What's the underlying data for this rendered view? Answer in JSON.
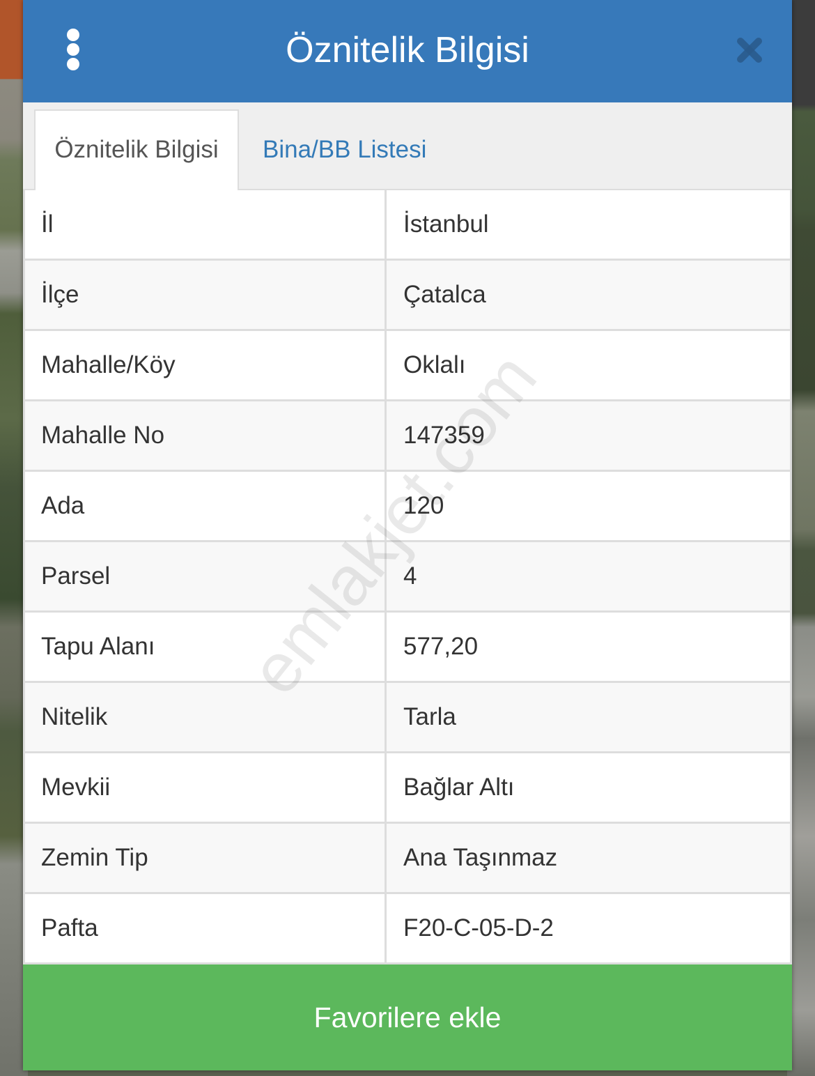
{
  "header": {
    "title": "Öznitelik Bilgisi",
    "menu_icon": "kebab-menu-icon",
    "close_icon": "close-icon"
  },
  "tabs": [
    {
      "label": "Öznitelik Bilgisi",
      "active": true
    },
    {
      "label": "Bina/BB Listesi",
      "active": false
    }
  ],
  "attributes": [
    {
      "label": "İl",
      "value": "İstanbul"
    },
    {
      "label": "İlçe",
      "value": "Çatalca"
    },
    {
      "label": "Mahalle/Köy",
      "value": "Oklalı"
    },
    {
      "label": "Mahalle No",
      "value": "147359"
    },
    {
      "label": "Ada",
      "value": "120"
    },
    {
      "label": "Parsel",
      "value": "4"
    },
    {
      "label": "Tapu Alanı",
      "value": "577,20"
    },
    {
      "label": "Nitelik",
      "value": "Tarla"
    },
    {
      "label": "Mevkii",
      "value": "Bağlar Altı"
    },
    {
      "label": "Zemin Tip",
      "value": "Ana Taşınmaz"
    },
    {
      "label": "Pafta",
      "value": "F20-C-05-D-2"
    }
  ],
  "actions": {
    "favorite_label": "Favorilere ekle"
  },
  "watermark": {
    "text": "emlakjet.com"
  },
  "colors": {
    "header": "#3779ba",
    "tab_link": "#337ab7",
    "primary_button": "#5cb85c",
    "text": "#333333"
  }
}
